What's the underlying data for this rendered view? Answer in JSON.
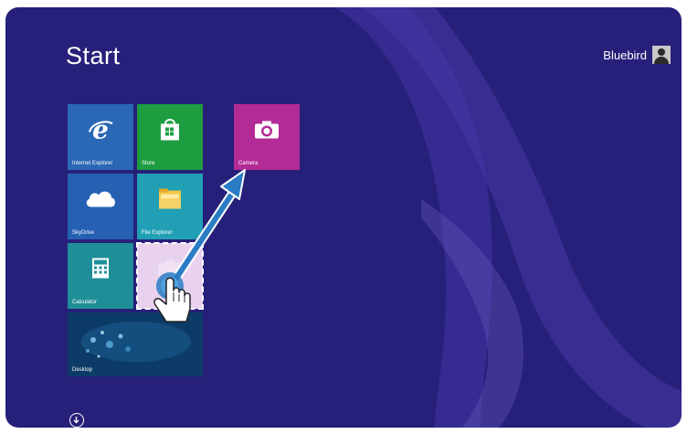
{
  "screen": {
    "title": "Start",
    "user_name": "Bluebird"
  },
  "tiles": {
    "internet_explorer": "Internet Explorer",
    "store": "Store",
    "camera": "Camera",
    "skydrive": "SkyDrive",
    "file_explorer": "File Explorer",
    "calculator": "Calculator",
    "desktop": "Desktop"
  },
  "icons": {
    "all_apps": "down-arrow-circle-icon",
    "gesture": "hand-pointer-icon",
    "drag": "drag-arrow-icon"
  },
  "colors": {
    "background": "#27207a",
    "ie": "#2a67b4",
    "store": "#1d9c40",
    "camera": "#b32b96",
    "skydrive": "#2560b3",
    "file_explorer": "#21a0b5",
    "calculator": "#1f8e97",
    "desktop": "#0c3b67",
    "arrow": "#2a7cc4"
  }
}
